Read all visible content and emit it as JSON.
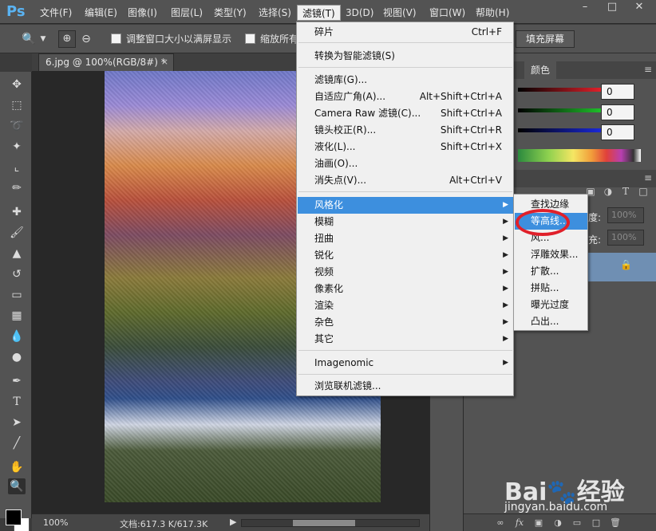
{
  "app": {
    "logo": "Ps"
  },
  "menubar": {
    "items": [
      "文件(F)",
      "编辑(E)",
      "图像(I)",
      "图层(L)",
      "类型(Y)",
      "选择(S)",
      "滤镜(T)",
      "3D(D)",
      "视图(V)",
      "窗口(W)",
      "帮助(H)"
    ],
    "active": "滤镜(T)",
    "window_controls": [
      "–",
      "□",
      "✕"
    ]
  },
  "options": {
    "resize_window_label": "调整窗口大小以满屏显示",
    "zoom_all_label": "缩放所有",
    "fill_screen_label": "填充屏幕"
  },
  "document": {
    "tab_title": "6.jpg @ 100%(RGB/8#) *",
    "tab_close": "×"
  },
  "status": {
    "zoom": "100%",
    "doc_size": "文档:617.3 K/617.3K"
  },
  "color_panel": {
    "tab": "颜色",
    "r": "0",
    "g": "0",
    "b": "0",
    "colors": {
      "r": "#e0202a",
      "g": "#1fbf2a",
      "b": "#1a28d8"
    }
  },
  "layers_panel": {
    "opacity_label": "度:",
    "opacity_value": "100%",
    "fill_label": "充:",
    "fill_value": "100%"
  },
  "filter_menu": {
    "last_filter": {
      "label": "碎片",
      "shortcut": "Ctrl+F"
    },
    "smart": "转换为智能滤镜(S)",
    "group1": [
      {
        "label": "滤镜库(G)...",
        "shortcut": ""
      },
      {
        "label": "自适应广角(A)...",
        "shortcut": "Alt+Shift+Ctrl+A"
      },
      {
        "label": "Camera Raw 滤镜(C)...",
        "shortcut": "Shift+Ctrl+A"
      },
      {
        "label": "镜头校正(R)...",
        "shortcut": "Shift+Ctrl+R"
      },
      {
        "label": "液化(L)...",
        "shortcut": "Shift+Ctrl+X"
      },
      {
        "label": "油画(O)...",
        "shortcut": ""
      },
      {
        "label": "消失点(V)...",
        "shortcut": "Alt+Ctrl+V"
      }
    ],
    "group2": [
      "风格化",
      "模糊",
      "扭曲",
      "锐化",
      "视频",
      "像素化",
      "渲染",
      "杂色",
      "其它"
    ],
    "highlighted": "风格化",
    "imagenomic": "Imagenomic",
    "browse": "浏览联机滤镜..."
  },
  "stylize_submenu": {
    "items": [
      "查找边缘",
      "等高线...",
      "风...",
      "浮雕效果...",
      "扩散...",
      "拼贴...",
      "曝光过度",
      "凸出..."
    ],
    "highlighted": "等高线..."
  },
  "watermark": {
    "logo": "Bai🐾经验",
    "url": "jingyan.baidu.com"
  }
}
